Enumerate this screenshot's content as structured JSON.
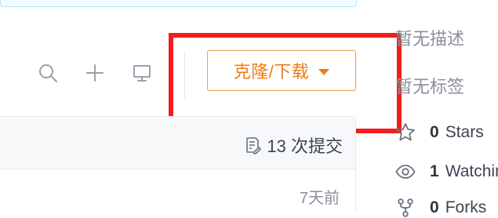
{
  "toolbar": {
    "search_icon": "search-icon",
    "add_icon": "plus-icon",
    "monitor_icon": "monitor-icon",
    "clone_label": "克隆/下载",
    "clone_color": "#ec7c16"
  },
  "commits": {
    "label": "13 次提交"
  },
  "file_row": {
    "time": "7天前"
  },
  "sidebar": {
    "description": "暂无描述",
    "tags": "暂无标签",
    "stats": [
      {
        "count": "0",
        "label": "Stars"
      },
      {
        "count": "1",
        "label": "Watching"
      },
      {
        "count": "0",
        "label": "Forks"
      }
    ]
  },
  "colors": {
    "highlight": "#f21d1d",
    "accent": "#ec7c16"
  }
}
